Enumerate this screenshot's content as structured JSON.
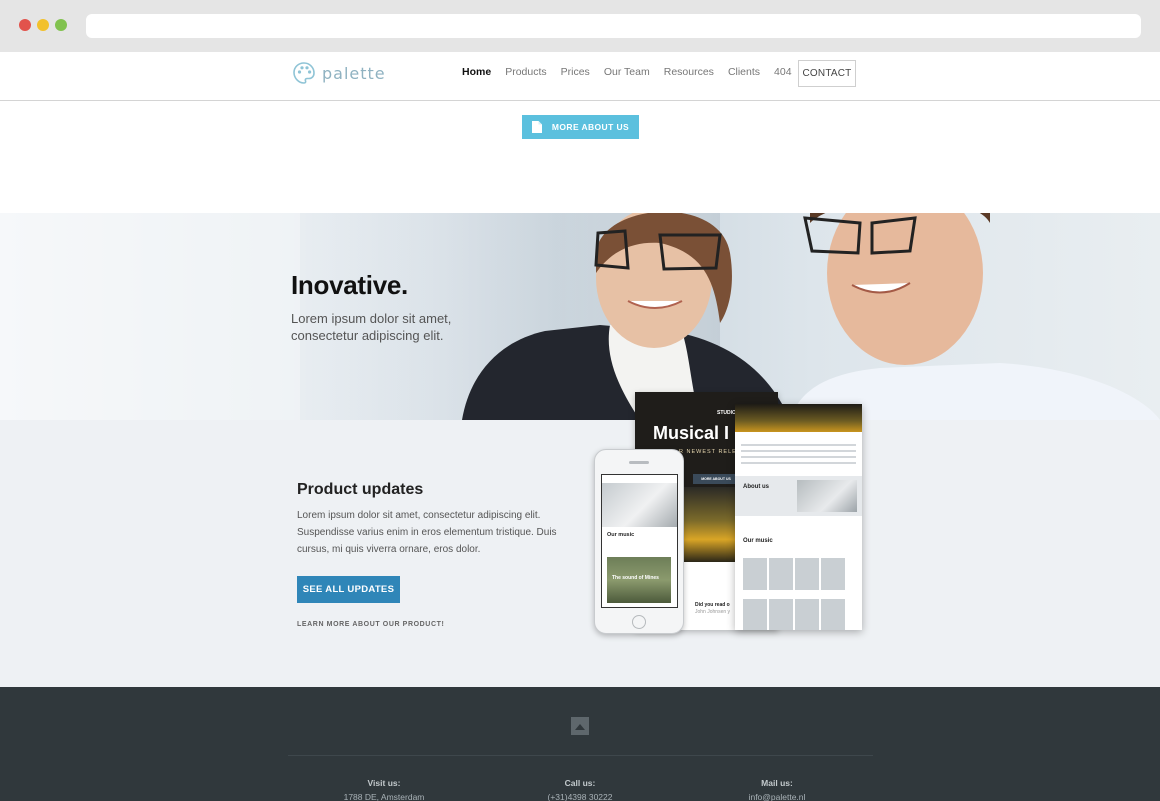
{
  "header": {
    "logo_text": "palette",
    "nav": [
      "Home",
      "Products",
      "Prices",
      "Our Team",
      "Resources",
      "Clients",
      "404"
    ],
    "contact_label": "CONTACT"
  },
  "about_button": {
    "label": "MORE ABOUT US",
    "icon": "document-icon"
  },
  "hero": {
    "title": "Inovative.",
    "subtitle": "Lorem ipsum dolor sit amet, consectetur adipiscing elit."
  },
  "product_updates": {
    "title": "Product updates",
    "text": "Lorem ipsum dolor sit amet, consectetur adipiscing elit. Suspendisse varius enim in eros elementum tristique. Duis cursus, mi quis viverra ornare, eros dolor.",
    "button_label": "SEE ALL UPDATES",
    "link_label": "LEARN MORE ABOUT OUR PRODUCT!"
  },
  "mockups": {
    "desktop_brand": "STUDIO",
    "desktop_title": "Musical I",
    "desktop_subtitle": "R NEWEST RELEA",
    "desktop_button": "MORE ABOUT US",
    "desktop_read": "Did you read o",
    "desktop_name": "John Johnsen y",
    "tablet_about": "About us",
    "tablet_music": "Our music",
    "phone_music": "Our music",
    "phone_tile": "The sound of Mines"
  },
  "footer": {
    "up_icon": "chevron-up-icon",
    "visit_label": "Visit us:",
    "visit_value": "1788 DE, Amsterdam",
    "call_label": "Call us:",
    "call_value": "(+31)4398 30222",
    "mail_label": "Mail us:",
    "mail_value": "info@palette.nl"
  },
  "colors": {
    "accent": "#5bc0de",
    "primary_button": "#2f86b8",
    "footer_bg": "#30383c",
    "section_bg": "#eef1f4"
  }
}
